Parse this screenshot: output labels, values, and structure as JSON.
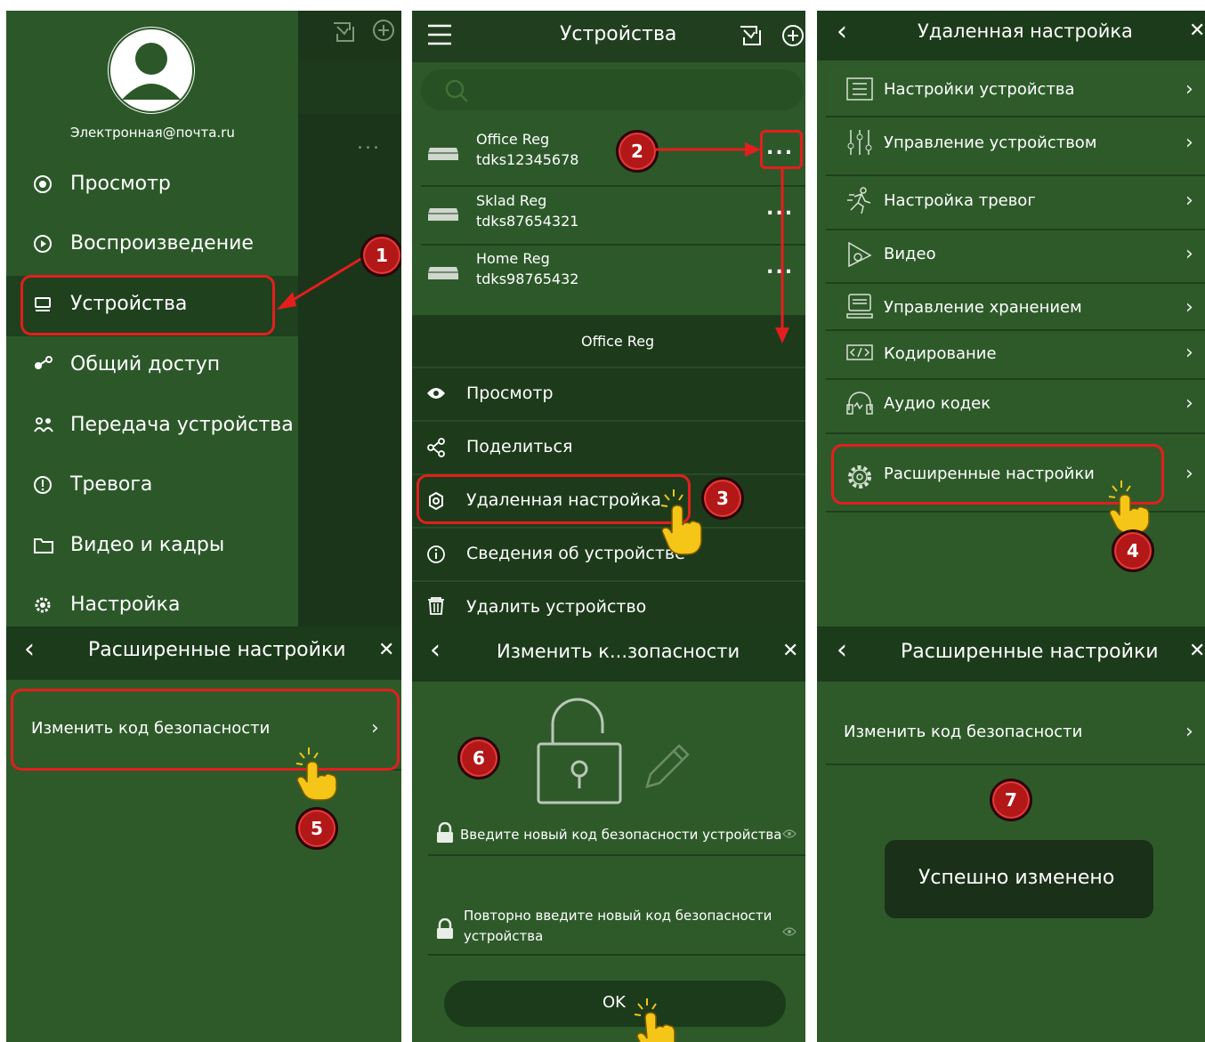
{
  "panel1": {
    "email": "Электронная@почта.ru",
    "menu": [
      "Просмотр",
      "Воспроизведение",
      "Устройства",
      "Общий доступ",
      "Передача устройства",
      "Тревога",
      "Видео и кадры",
      "Настройка"
    ],
    "bg_more": "..."
  },
  "panel2": {
    "title": "Устройства",
    "devices": [
      {
        "name": "Office Reg",
        "serial": "tdks12345678"
      },
      {
        "name": "Sklad Reg",
        "serial": "tdks87654321"
      },
      {
        "name": "Home Reg",
        "serial": "tdks98765432"
      }
    ],
    "more": "...",
    "popup_title": "Office Reg",
    "popup_items": [
      "Просмотр",
      "Поделиться",
      "Удаленная настройка",
      "Сведения об устройстве",
      "Удалить устройство"
    ]
  },
  "panel3": {
    "title": "Удаленная настройка",
    "close": "✕",
    "items": [
      "Настройки устройства",
      "Управление устройством",
      "Настройка тревог",
      "Видео",
      "Управление хранением",
      "Кодирование",
      "Аудио кодек",
      "Расширенные настройки"
    ]
  },
  "panel4": {
    "title": "Расширенные настройки",
    "close": "✕",
    "item": "Изменить код безопасности"
  },
  "panel5": {
    "title": "Изменить к...зопасности",
    "close": "✕",
    "field1": "Введите новый код безопасности устройства",
    "field2_line1": "Повторно введите новый код безопасности",
    "field2_line2": "устройства",
    "ok": "OK"
  },
  "panel6": {
    "title": "Расширенные настройки",
    "close": "✕",
    "item": "Изменить код безопасности",
    "toast": "Успешно изменено"
  },
  "badges": [
    "1",
    "2",
    "3",
    "4",
    "5",
    "6",
    "7"
  ],
  "colors": {
    "dark_green": "#1c3e1c",
    "green": "#2e5a2a",
    "row_green": "#355f31",
    "red": "#e41e1e",
    "badge": "#b31818",
    "hand": "#f5c518"
  }
}
